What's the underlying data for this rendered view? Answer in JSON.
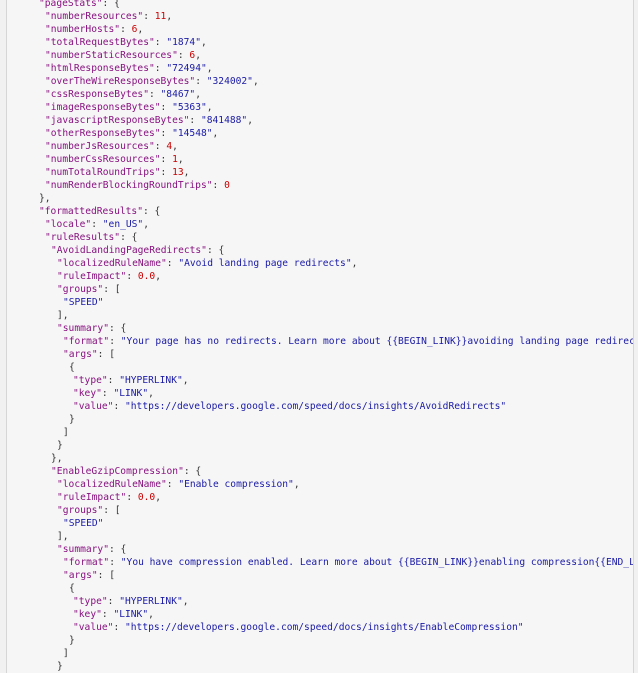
{
  "colors": {
    "key": "#881280",
    "string": "#1a1aa6",
    "number": "#c80000",
    "punctuation": "#333333",
    "background": "#f6f6f6"
  },
  "lines": [
    {
      "i": 0,
      "t": [
        [
          "k",
          "\"pageStats\""
        ],
        [
          "p",
          ": {"
        ]
      ]
    },
    {
      "i": 1,
      "t": [
        [
          "k",
          "\"numberResources\""
        ],
        [
          "p",
          ": "
        ],
        [
          "n",
          "11"
        ],
        [
          "p",
          ","
        ]
      ]
    },
    {
      "i": 1,
      "t": [
        [
          "k",
          "\"numberHosts\""
        ],
        [
          "p",
          ": "
        ],
        [
          "n",
          "6"
        ],
        [
          "p",
          ","
        ]
      ]
    },
    {
      "i": 1,
      "t": [
        [
          "k",
          "\"totalRequestBytes\""
        ],
        [
          "p",
          ": "
        ],
        [
          "s",
          "\"1874\""
        ],
        [
          "p",
          ","
        ]
      ]
    },
    {
      "i": 1,
      "t": [
        [
          "k",
          "\"numberStaticResources\""
        ],
        [
          "p",
          ": "
        ],
        [
          "n",
          "6"
        ],
        [
          "p",
          ","
        ]
      ]
    },
    {
      "i": 1,
      "t": [
        [
          "k",
          "\"htmlResponseBytes\""
        ],
        [
          "p",
          ": "
        ],
        [
          "s",
          "\"72494\""
        ],
        [
          "p",
          ","
        ]
      ]
    },
    {
      "i": 1,
      "t": [
        [
          "k",
          "\"overTheWireResponseBytes\""
        ],
        [
          "p",
          ": "
        ],
        [
          "s",
          "\"324002\""
        ],
        [
          "p",
          ","
        ]
      ]
    },
    {
      "i": 1,
      "t": [
        [
          "k",
          "\"cssResponseBytes\""
        ],
        [
          "p",
          ": "
        ],
        [
          "s",
          "\"8467\""
        ],
        [
          "p",
          ","
        ]
      ]
    },
    {
      "i": 1,
      "t": [
        [
          "k",
          "\"imageResponseBytes\""
        ],
        [
          "p",
          ": "
        ],
        [
          "s",
          "\"5363\""
        ],
        [
          "p",
          ","
        ]
      ]
    },
    {
      "i": 1,
      "t": [
        [
          "k",
          "\"javascriptResponseBytes\""
        ],
        [
          "p",
          ": "
        ],
        [
          "s",
          "\"841488\""
        ],
        [
          "p",
          ","
        ]
      ]
    },
    {
      "i": 1,
      "t": [
        [
          "k",
          "\"otherResponseBytes\""
        ],
        [
          "p",
          ": "
        ],
        [
          "s",
          "\"14548\""
        ],
        [
          "p",
          ","
        ]
      ]
    },
    {
      "i": 1,
      "t": [
        [
          "k",
          "\"numberJsResources\""
        ],
        [
          "p",
          ": "
        ],
        [
          "n",
          "4"
        ],
        [
          "p",
          ","
        ]
      ]
    },
    {
      "i": 1,
      "t": [
        [
          "k",
          "\"numberCssResources\""
        ],
        [
          "p",
          ": "
        ],
        [
          "n",
          "1"
        ],
        [
          "p",
          ","
        ]
      ]
    },
    {
      "i": 1,
      "t": [
        [
          "k",
          "\"numTotalRoundTrips\""
        ],
        [
          "p",
          ": "
        ],
        [
          "n",
          "13"
        ],
        [
          "p",
          ","
        ]
      ]
    },
    {
      "i": 1,
      "t": [
        [
          "k",
          "\"numRenderBlockingRoundTrips\""
        ],
        [
          "p",
          ": "
        ],
        [
          "n",
          "0"
        ]
      ]
    },
    {
      "i": 0,
      "t": [
        [
          "p",
          "},"
        ]
      ]
    },
    {
      "i": 0,
      "t": [
        [
          "k",
          "\"formattedResults\""
        ],
        [
          "p",
          ": {"
        ]
      ]
    },
    {
      "i": 1,
      "t": [
        [
          "k",
          "\"locale\""
        ],
        [
          "p",
          ": "
        ],
        [
          "s",
          "\"en_US\""
        ],
        [
          "p",
          ","
        ]
      ]
    },
    {
      "i": 1,
      "t": [
        [
          "k",
          "\"ruleResults\""
        ],
        [
          "p",
          ": {"
        ]
      ]
    },
    {
      "i": 2,
      "t": [
        [
          "k",
          "\"AvoidLandingPageRedirects\""
        ],
        [
          "p",
          ": {"
        ]
      ]
    },
    {
      "i": 3,
      "t": [
        [
          "k",
          "\"localizedRuleName\""
        ],
        [
          "p",
          ": "
        ],
        [
          "s",
          "\"Avoid landing page redirects\""
        ],
        [
          "p",
          ","
        ]
      ]
    },
    {
      "i": 3,
      "t": [
        [
          "k",
          "\"ruleImpact\""
        ],
        [
          "p",
          ": "
        ],
        [
          "n",
          "0.0"
        ],
        [
          "p",
          ","
        ]
      ]
    },
    {
      "i": 3,
      "t": [
        [
          "k",
          "\"groups\""
        ],
        [
          "p",
          ": ["
        ]
      ]
    },
    {
      "i": 4,
      "t": [
        [
          "s",
          "\"SPEED\""
        ]
      ]
    },
    {
      "i": 3,
      "t": [
        [
          "p",
          "],"
        ]
      ]
    },
    {
      "i": 3,
      "t": [
        [
          "k",
          "\"summary\""
        ],
        [
          "p",
          ": {"
        ]
      ]
    },
    {
      "i": 4,
      "t": [
        [
          "k",
          "\"format\""
        ],
        [
          "p",
          ": "
        ],
        [
          "s",
          "\"Your page has no redirects. Learn more about {{BEGIN_LINK}}avoiding landing page redirects{"
        ]
      ]
    },
    {
      "i": 4,
      "t": [
        [
          "k",
          "\"args\""
        ],
        [
          "p",
          ": ["
        ]
      ]
    },
    {
      "i": 5,
      "t": [
        [
          "p",
          "{"
        ]
      ]
    },
    {
      "i": 6,
      "t": [
        [
          "k",
          "\"type\""
        ],
        [
          "p",
          ": "
        ],
        [
          "s",
          "\"HYPERLINK\""
        ],
        [
          "p",
          ","
        ]
      ]
    },
    {
      "i": 6,
      "t": [
        [
          "k",
          "\"key\""
        ],
        [
          "p",
          ": "
        ],
        [
          "s",
          "\"LINK\""
        ],
        [
          "p",
          ","
        ]
      ]
    },
    {
      "i": 6,
      "t": [
        [
          "k",
          "\"value\""
        ],
        [
          "p",
          ": "
        ],
        [
          "s",
          "\"https://developers.google.com/speed/docs/insights/AvoidRedirects\""
        ]
      ]
    },
    {
      "i": 5,
      "t": [
        [
          "p",
          "}"
        ]
      ]
    },
    {
      "i": 4,
      "t": [
        [
          "p",
          "]"
        ]
      ]
    },
    {
      "i": 3,
      "t": [
        [
          "p",
          "}"
        ]
      ]
    },
    {
      "i": 2,
      "t": [
        [
          "p",
          "},"
        ]
      ]
    },
    {
      "i": 2,
      "t": [
        [
          "k",
          "\"EnableGzipCompression\""
        ],
        [
          "p",
          ": {"
        ]
      ]
    },
    {
      "i": 3,
      "t": [
        [
          "k",
          "\"localizedRuleName\""
        ],
        [
          "p",
          ": "
        ],
        [
          "s",
          "\"Enable compression\""
        ],
        [
          "p",
          ","
        ]
      ]
    },
    {
      "i": 3,
      "t": [
        [
          "k",
          "\"ruleImpact\""
        ],
        [
          "p",
          ": "
        ],
        [
          "n",
          "0.0"
        ],
        [
          "p",
          ","
        ]
      ]
    },
    {
      "i": 3,
      "t": [
        [
          "k",
          "\"groups\""
        ],
        [
          "p",
          ": ["
        ]
      ]
    },
    {
      "i": 4,
      "t": [
        [
          "s",
          "\"SPEED\""
        ]
      ]
    },
    {
      "i": 3,
      "t": [
        [
          "p",
          "],"
        ]
      ]
    },
    {
      "i": 3,
      "t": [
        [
          "k",
          "\"summary\""
        ],
        [
          "p",
          ": {"
        ]
      ]
    },
    {
      "i": 4,
      "t": [
        [
          "k",
          "\"format\""
        ],
        [
          "p",
          ": "
        ],
        [
          "s",
          "\"You have compression enabled. Learn more about {{BEGIN_LINK}}enabling compression{{END_LINK"
        ]
      ]
    },
    {
      "i": 4,
      "t": [
        [
          "k",
          "\"args\""
        ],
        [
          "p",
          ": ["
        ]
      ]
    },
    {
      "i": 5,
      "t": [
        [
          "p",
          "{"
        ]
      ]
    },
    {
      "i": 6,
      "t": [
        [
          "k",
          "\"type\""
        ],
        [
          "p",
          ": "
        ],
        [
          "s",
          "\"HYPERLINK\""
        ],
        [
          "p",
          ","
        ]
      ]
    },
    {
      "i": 6,
      "t": [
        [
          "k",
          "\"key\""
        ],
        [
          "p",
          ": "
        ],
        [
          "s",
          "\"LINK\""
        ],
        [
          "p",
          ","
        ]
      ]
    },
    {
      "i": 6,
      "t": [
        [
          "k",
          "\"value\""
        ],
        [
          "p",
          ": "
        ],
        [
          "s",
          "\"https://developers.google.com/speed/docs/insights/EnableCompression\""
        ]
      ]
    },
    {
      "i": 5,
      "t": [
        [
          "p",
          "}"
        ]
      ]
    },
    {
      "i": 4,
      "t": [
        [
          "p",
          "]"
        ]
      ]
    },
    {
      "i": 3,
      "t": [
        [
          "p",
          "}"
        ]
      ]
    }
  ]
}
